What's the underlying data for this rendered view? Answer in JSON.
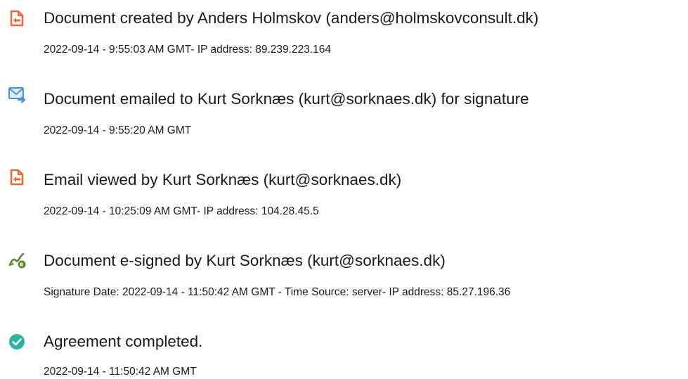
{
  "audit_events": [
    {
      "icon": "document-created-icon",
      "title": "Document created by Anders Holmskov (anders@holmskovconsult.dk)",
      "detail": "2022-09-14 - 9:55:03 AM GMT- IP address: 89.239.223.164"
    },
    {
      "icon": "document-emailed-icon",
      "title": "Document emailed to Kurt Sorknæs (kurt@sorknaes.dk) for signature",
      "detail": "2022-09-14 - 9:55:20 AM GMT"
    },
    {
      "icon": "email-viewed-icon",
      "title": "Email viewed by Kurt Sorknæs (kurt@sorknaes.dk)",
      "detail": "2022-09-14 - 10:25:09 AM GMT- IP address: 104.28.45.5"
    },
    {
      "icon": "e-signed-icon",
      "title": "Document e-signed by Kurt Sorknæs (kurt@sorknaes.dk)",
      "detail": "Signature Date: 2022-09-14 - 11:50:42 AM GMT - Time Source: server- IP address: 85.27.196.36"
    },
    {
      "icon": "agreement-completed-icon",
      "title": "Agreement completed.",
      "detail": "2022-09-14 - 11:50:42 AM GMT"
    }
  ],
  "colors": {
    "document_icon": "#e8693a",
    "email_icon": "#4a90d9",
    "signature_icon": "#5a8a2a",
    "completed_icon": "#2bb3a0",
    "text": "#1a1a1a"
  }
}
